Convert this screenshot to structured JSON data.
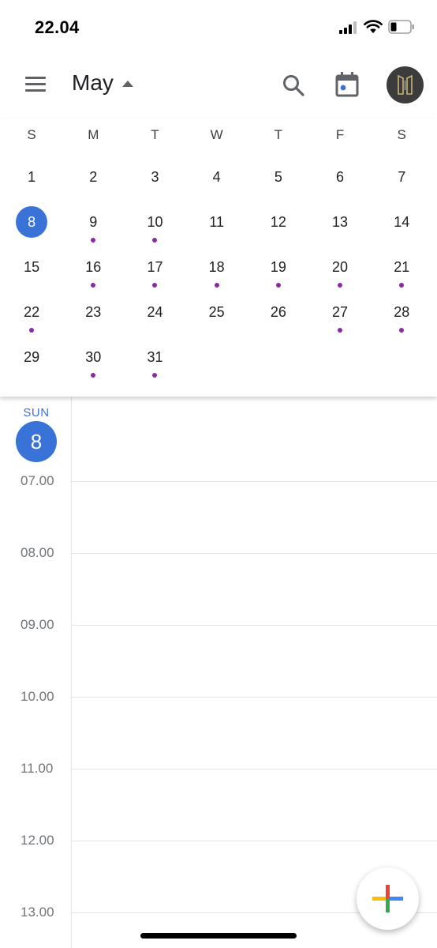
{
  "status_bar": {
    "time": "22.04"
  },
  "header": {
    "month": "May"
  },
  "calendar": {
    "weekdays": [
      "S",
      "M",
      "T",
      "W",
      "T",
      "F",
      "S"
    ],
    "weeks": [
      [
        {
          "d": "1",
          "e": false
        },
        {
          "d": "2",
          "e": false
        },
        {
          "d": "3",
          "e": false
        },
        {
          "d": "4",
          "e": false
        },
        {
          "d": "5",
          "e": false
        },
        {
          "d": "6",
          "e": false
        },
        {
          "d": "7",
          "e": false
        }
      ],
      [
        {
          "d": "8",
          "e": false,
          "sel": true
        },
        {
          "d": "9",
          "e": true
        },
        {
          "d": "10",
          "e": true
        },
        {
          "d": "11",
          "e": false
        },
        {
          "d": "12",
          "e": false
        },
        {
          "d": "13",
          "e": false
        },
        {
          "d": "14",
          "e": false
        }
      ],
      [
        {
          "d": "15",
          "e": false
        },
        {
          "d": "16",
          "e": true
        },
        {
          "d": "17",
          "e": true
        },
        {
          "d": "18",
          "e": true
        },
        {
          "d": "19",
          "e": true
        },
        {
          "d": "20",
          "e": true
        },
        {
          "d": "21",
          "e": true
        }
      ],
      [
        {
          "d": "22",
          "e": true
        },
        {
          "d": "23",
          "e": false
        },
        {
          "d": "24",
          "e": false
        },
        {
          "d": "25",
          "e": false
        },
        {
          "d": "26",
          "e": false
        },
        {
          "d": "27",
          "e": true
        },
        {
          "d": "28",
          "e": true
        }
      ],
      [
        {
          "d": "29",
          "e": false
        },
        {
          "d": "30",
          "e": true
        },
        {
          "d": "31",
          "e": true
        }
      ]
    ],
    "selected_day": "8"
  },
  "day_view": {
    "day_of_week": "SUN",
    "day_number": "8",
    "hours": [
      "07.00",
      "08.00",
      "09.00",
      "10.00",
      "11.00",
      "12.00",
      "13.00"
    ]
  },
  "icons": {
    "menu": "menu-icon",
    "caret": "caret-up-icon",
    "search": "search-icon",
    "today": "calendar-today-icon",
    "fab": "plus-icon"
  },
  "colors": {
    "accent": "#3a73d8",
    "event_dot": "#8b2aa6",
    "fab_red": "#ea4335",
    "fab_blue": "#4285f4",
    "fab_yellow": "#fbbc04",
    "fab_green": "#34a853"
  }
}
